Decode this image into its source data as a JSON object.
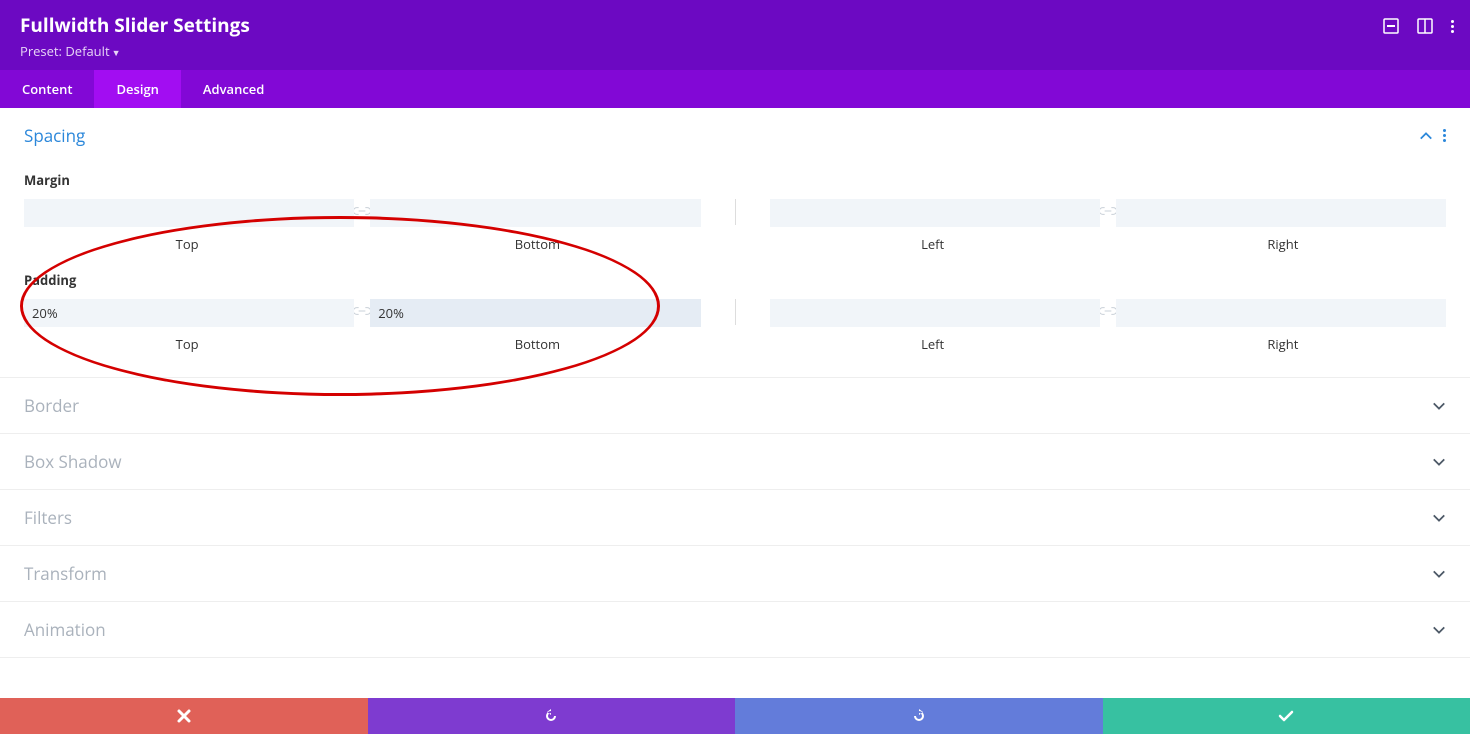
{
  "header": {
    "title": "Fullwidth Slider Settings",
    "preset": "Preset: Default"
  },
  "tabs": {
    "content": "Content",
    "design": "Design",
    "advanced": "Advanced"
  },
  "spacing": {
    "title": "Spacing",
    "margin_label": "Margin",
    "padding_label": "Padding",
    "labels": {
      "top": "Top",
      "bottom": "Bottom",
      "left": "Left",
      "right": "Right"
    },
    "margin": {
      "top": "",
      "bottom": "",
      "left": "",
      "right": ""
    },
    "padding": {
      "top": "20%",
      "bottom": "20%",
      "left": "",
      "right": ""
    }
  },
  "sections": {
    "border": "Border",
    "box_shadow": "Box Shadow",
    "filters": "Filters",
    "transform": "Transform",
    "animation": "Animation"
  }
}
